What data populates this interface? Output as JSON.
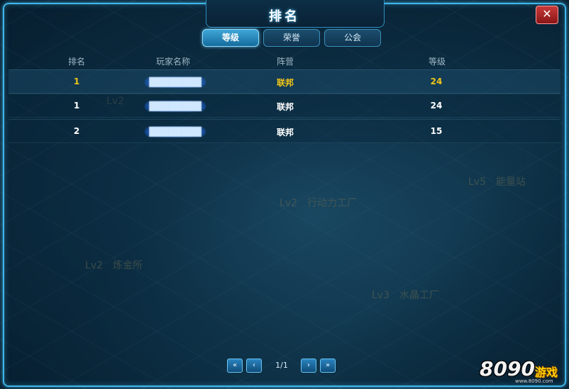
{
  "window": {
    "title": "排名",
    "close_label": "✕"
  },
  "tabs": [
    {
      "label": "等级",
      "active": true
    },
    {
      "label": "荣誉",
      "active": false
    },
    {
      "label": "公会",
      "active": false
    }
  ],
  "table": {
    "headers": {
      "rank": "排名",
      "name": "玩家名称",
      "camp": "阵营",
      "level": "等级"
    },
    "rows": [
      {
        "rank": "1",
        "name": "████████",
        "camp": "联邦",
        "level": "24",
        "highlight_color": "#f0c419"
      },
      {
        "rank": "1",
        "name": "████████",
        "camp": "联邦",
        "level": "24",
        "highlight_color": "#ffffff"
      },
      {
        "rank": "2",
        "name": "████████",
        "camp": "联邦",
        "level": "15",
        "highlight_color": "#ffffff"
      }
    ]
  },
  "background_labels": [
    {
      "lv": "Lv2",
      "name": "行动力工厂"
    },
    {
      "lv": "Lv5",
      "name": "能量站"
    },
    {
      "lv": "Lv2",
      "name": "炼金所"
    },
    {
      "lv": "Lv3",
      "name": "水晶工厂"
    },
    {
      "lv": "Lv2",
      "name": ""
    }
  ],
  "pagination": {
    "first": "«",
    "prev": "‹",
    "page_text": "1/1",
    "next": "›",
    "last": "»"
  },
  "watermark": {
    "number": "8090",
    "word": "游戏",
    "url": "www.8090.com"
  },
  "colors": {
    "frame": "#3fb6e8",
    "first_row_text": "#f0c419",
    "accent": "#4fc3f7"
  }
}
